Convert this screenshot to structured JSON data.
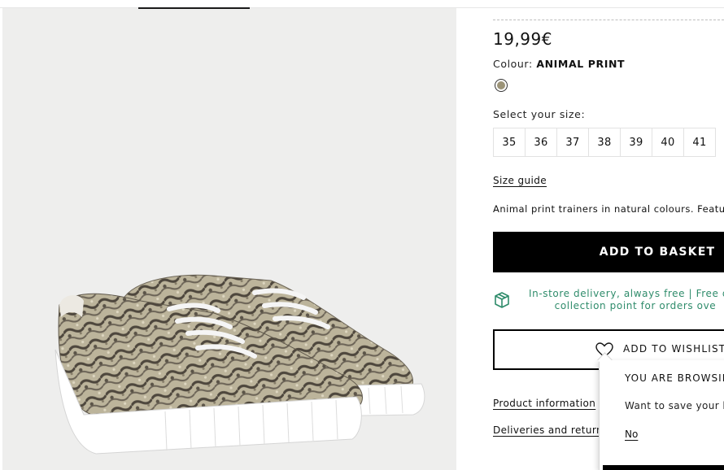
{
  "product": {
    "price": "19,99€",
    "colour_label": "Colour:",
    "colour_value": "ANIMAL PRINT",
    "swatch_color": "#9c9478",
    "size_prompt": "Select your size:",
    "sizes": [
      "35",
      "36",
      "37",
      "38",
      "39",
      "40",
      "41"
    ],
    "size_guide": "Size guide",
    "description": "Animal print trainers in natural colours. Featuring",
    "add_to_basket": "ADD TO BASKET",
    "delivery_line1": "In-store delivery, always free | Free deli",
    "delivery_line2": "collection point for orders ove",
    "add_to_wishlist": "ADD TO WISHLIST",
    "product_information": "Product information",
    "deliveries_returns": "Deliveries and returns"
  },
  "popup": {
    "title": "YOU ARE BROWSING",
    "text": "Want to save your loc",
    "no": "No"
  },
  "icons": {
    "delivery": "package-icon",
    "wishlist": "heart-icon"
  },
  "colors": {
    "accent_green": "#2f8c6b",
    "button_black": "#000000",
    "gallery_bg": "#eeeeed"
  }
}
